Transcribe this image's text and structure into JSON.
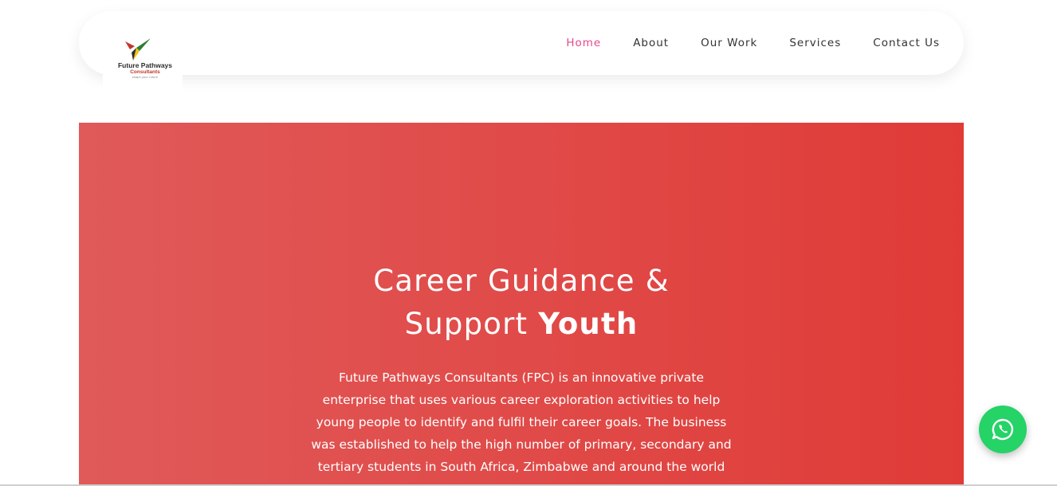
{
  "brand": {
    "name": "Future Pathways",
    "sub": "Consultants",
    "tagline": "shape your future",
    "colors": {
      "red": "#c0392b",
      "green": "#2e7d32",
      "yellow": "#f1c40f",
      "dark": "#2d2d2d"
    }
  },
  "nav": {
    "items": [
      {
        "label": "Home",
        "active": true
      },
      {
        "label": "About",
        "active": false
      },
      {
        "label": "Our Work",
        "active": false
      },
      {
        "label": "Services",
        "active": false
      },
      {
        "label": "Contact Us",
        "active": false
      }
    ],
    "active_color": "#e8478b"
  },
  "hero": {
    "title_line1": "Career Guidance &",
    "title_line2_regular": "Support",
    "title_line2_bold": "Youth",
    "description": "Future Pathways Consultants (FPC) is an innovative private enterprise that uses various career exploration activities to help young people to identify and fulfil their career goals. The business was established to help the high number of primary, secondary and tertiary students in South Africa, Zimbabwe and around the world",
    "gradient": [
      "#e05a5a",
      "#e03b37"
    ]
  },
  "whatsapp": {
    "icon": "whatsapp-icon",
    "color": "#25d366"
  }
}
